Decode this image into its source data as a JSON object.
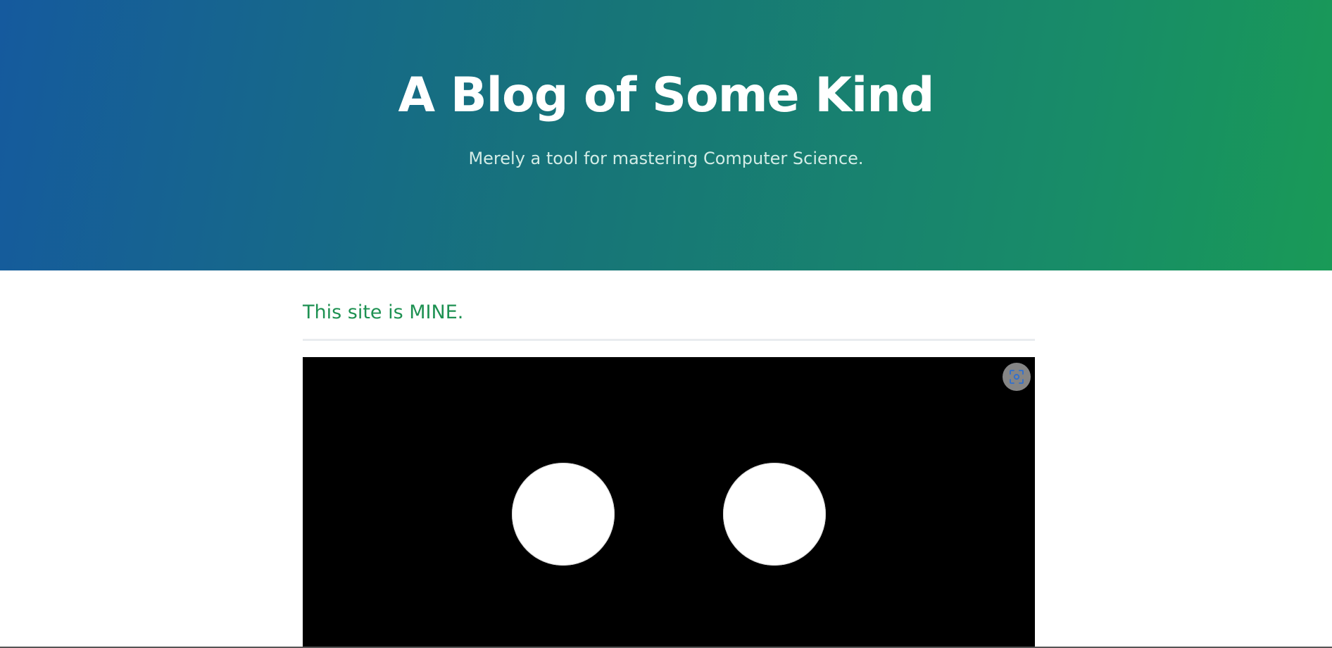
{
  "header": {
    "title": "A Blog of Some Kind",
    "subtitle": "Merely a tool for mastering Computer Science."
  },
  "main": {
    "tagline": "This site is MINE.",
    "canvas": {
      "background_color": "#000000",
      "shapes": [
        "white-circle",
        "white-circle"
      ],
      "fullscreen_button_icon": "fullscreen-focus-icon"
    }
  },
  "colors": {
    "gradient_start": "#155a9e",
    "gradient_end": "#199a57",
    "accent_green": "#1e9152",
    "fullscreen_icon_color": "#2f6fd0"
  }
}
